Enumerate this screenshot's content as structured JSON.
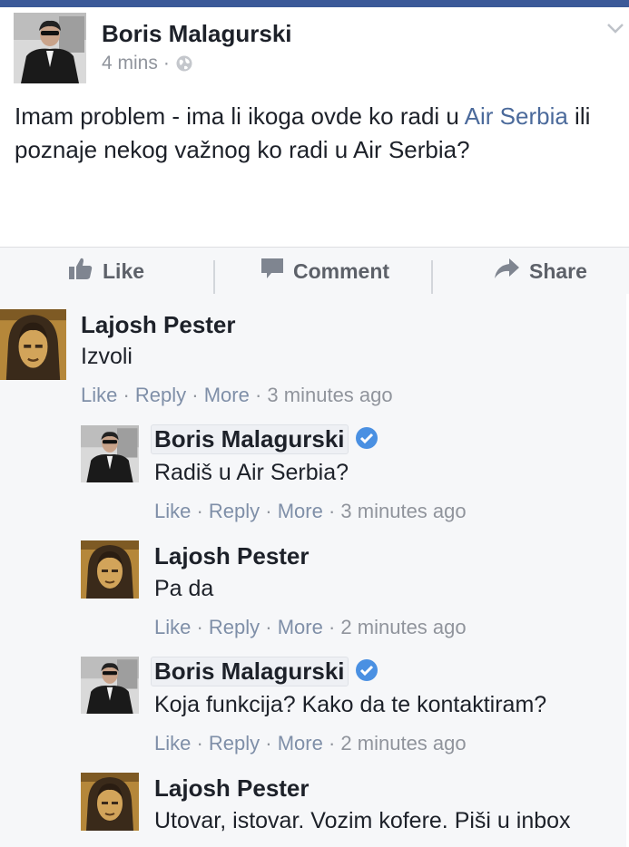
{
  "post": {
    "author": "Boris Malagurski",
    "time": "4 mins",
    "dot": "·",
    "text_before": "Imam problem - ima li ikoga ovde ko radi u ",
    "link": "Air Serbia",
    "text_after": " ili poznaje nekog važnog ko radi u Air Serbia?"
  },
  "actions": {
    "like": "Like",
    "comment": "Comment",
    "share": "Share"
  },
  "comments": [
    {
      "author": "Lajosh Pester",
      "text": "Izvoli",
      "like": "Like",
      "reply": "Reply",
      "more": "More",
      "time": "3 minutes ago",
      "verified": false
    },
    {
      "author": "Boris Malagurski",
      "text": "Radiš u Air Serbia?",
      "like": "Like",
      "reply": "Reply",
      "more": "More",
      "time": "3 minutes ago",
      "verified": true
    },
    {
      "author": "Lajosh Pester",
      "text": "Pa da",
      "like": "Like",
      "reply": "Reply",
      "more": "More",
      "time": "2 minutes ago",
      "verified": false
    },
    {
      "author": "Boris Malagurski",
      "text": "Koja funkcija? Kako da te kontaktiram?",
      "like": "Like",
      "reply": "Reply",
      "more": "More",
      "time": "2 minutes ago",
      "verified": true
    },
    {
      "author": "Lajosh Pester",
      "text": "Utovar, istovar. Vozim kofere. Piši u inbox",
      "verified": false
    }
  ],
  "sep": " · ",
  "colors": {
    "brand": "#3b5998",
    "link": "#4b6a9b",
    "meta": "#90949c",
    "verified": "#4a90e2",
    "comments_bg": "#f6f7f9"
  },
  "icons": [
    "globe-icon",
    "chevron-down-icon",
    "thumbs-up-icon",
    "comment-icon",
    "share-icon",
    "verified-icon"
  ]
}
